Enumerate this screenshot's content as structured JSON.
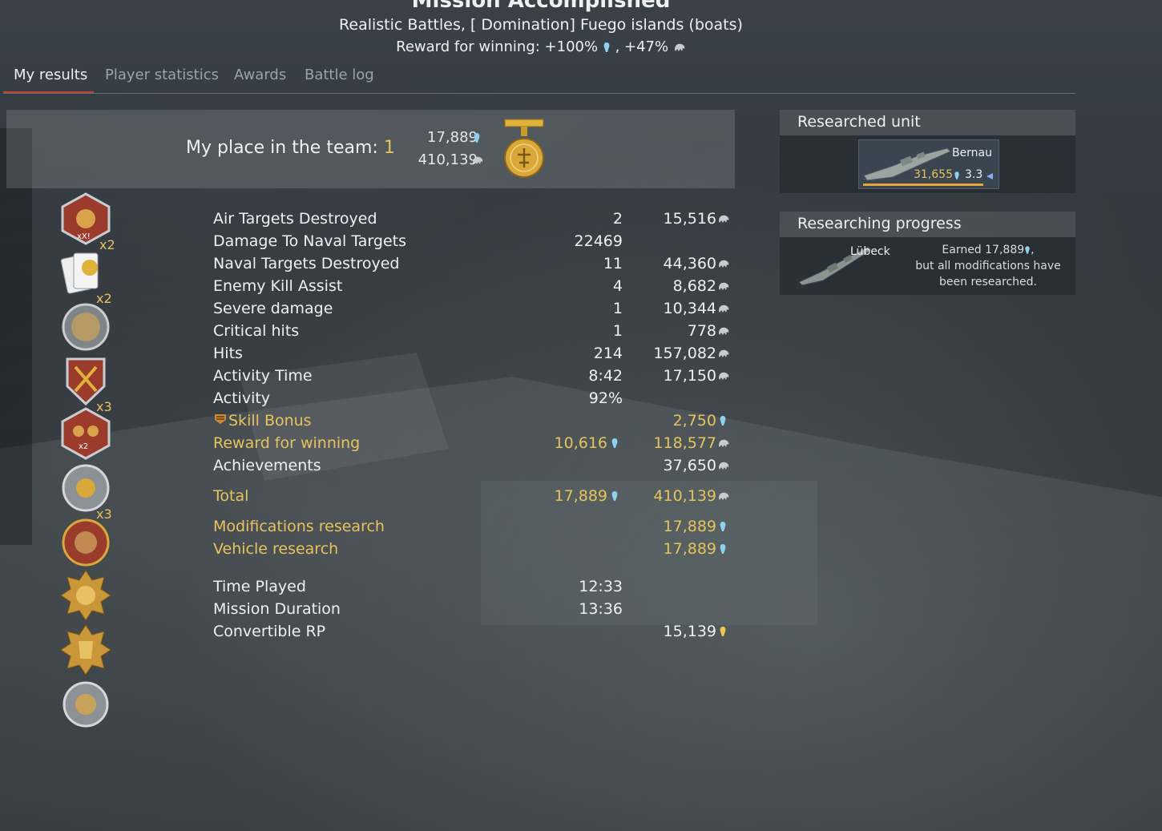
{
  "header": {
    "title": "Mission Accomplished",
    "subtitle": "Realistic Battles, [ Domination] Fuego islands (boats)",
    "reward_prefix": "Reward for winning: +100%",
    "reward_sep": ", +47%"
  },
  "tabs": [
    "My results",
    "Player statistics",
    "Awards",
    "Battle log"
  ],
  "team": {
    "label": "My place in the team: ",
    "place": "1",
    "rp": "17,889",
    "sl": "410,139"
  },
  "badges": {
    "multipliers": [
      "x2",
      "x2",
      "x3",
      "x3"
    ]
  },
  "rows": [
    {
      "label": "Air Targets Destroyed",
      "v1": "2",
      "v2": "15,516"
    },
    {
      "label": "Damage To Naval Targets",
      "v1": "22469",
      "v2": ""
    },
    {
      "label": "Naval Targets Destroyed",
      "v1": "11",
      "v2": "44,360"
    },
    {
      "label": "Enemy Kill Assist",
      "v1": "4",
      "v2": "8,682"
    },
    {
      "label": "Severe damage",
      "v1": "1",
      "v2": "10,344"
    },
    {
      "label": "Critical hits",
      "v1": "1",
      "v2": "778"
    },
    {
      "label": "Hits",
      "v1": "214",
      "v2": "157,082"
    },
    {
      "label": "Activity Time",
      "v1": "8:42",
      "v2": "17,150"
    },
    {
      "label": "Activity",
      "v1": "92%",
      "v2": ""
    },
    {
      "label": "Skill Bonus",
      "v1": "",
      "v2": "2,750"
    },
    {
      "label": "Reward for winning",
      "v1": "10,616",
      "v2": "118,577"
    },
    {
      "label": "Achievements",
      "v1": "",
      "v2": "37,650"
    },
    {
      "label": "Total",
      "v1": "17,889",
      "v2": "410,139"
    },
    {
      "label": "Modifications research",
      "v1": "",
      "v2": "17,889"
    },
    {
      "label": "Vehicle research",
      "v1": "",
      "v2": "17,889"
    },
    {
      "label": "Time Played",
      "v1": "12:33",
      "v2": ""
    },
    {
      "label": "Mission Duration",
      "v1": "13:36",
      "v2": ""
    },
    {
      "label": "Convertible RP",
      "v1": "",
      "v2": "15,139"
    }
  ],
  "researched": {
    "title": "Researched unit",
    "unit": "Bernau",
    "rp": "31,655",
    "br": "3.3"
  },
  "progress": {
    "title": "Researching progress",
    "unit": "Lübeck",
    "line1": "Earned 17,889",
    "line1b": ",",
    "line2": "but all modifications have",
    "line3": "been researched."
  }
}
